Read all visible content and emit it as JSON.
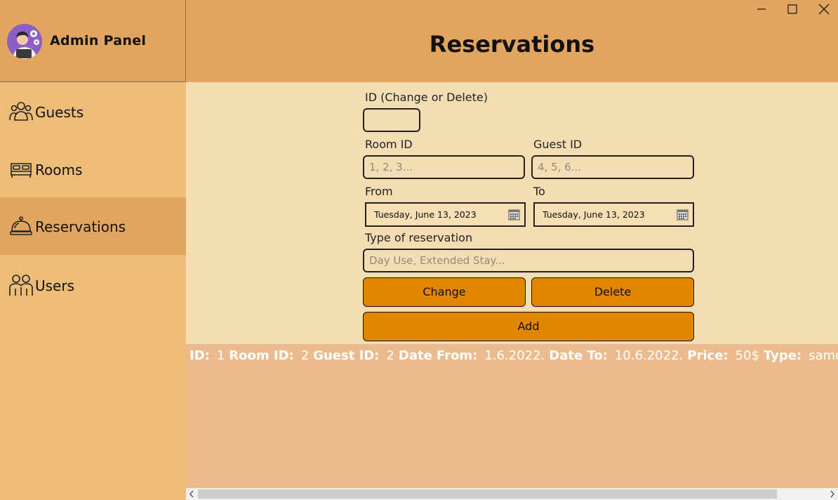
{
  "sidebar": {
    "title": "Admin Panel",
    "items": [
      {
        "label": "Guests"
      },
      {
        "label": "Rooms"
      },
      {
        "label": "Reservations"
      },
      {
        "label": "Users"
      }
    ],
    "active": "Reservations"
  },
  "header": {
    "title": "Reservations"
  },
  "form": {
    "id_label": "ID (Change or Delete)",
    "id_value": "",
    "room_id_label": "Room ID",
    "room_id_placeholder": "1, 2, 3...",
    "guest_id_label": "Guest ID",
    "guest_id_placeholder": "4, 5, 6...",
    "from_label": "From",
    "from_value": "Tuesday, June 13, 2023",
    "to_label": "To",
    "to_value": "Tuesday, June 13, 2023",
    "type_label": "Type of reservation",
    "type_placeholder": "Day Use, Extended Stay...",
    "change_button": "Change",
    "delete_button": "Delete",
    "add_button": "Add"
  },
  "list": {
    "rows": [
      {
        "id_key": "ID:",
        "id": "1",
        "room_key": "Room ID:",
        "room": "2",
        "guest_key": "Guest ID:",
        "guest": "2",
        "from_key": "Date From:",
        "from": "1.6.2022.",
        "to_key": "Date To:",
        "to": "10.6.2022.",
        "price_key": "Price:",
        "price": "50$",
        "type_key": "Type:",
        "type": "samo c"
      }
    ]
  },
  "colors": {
    "accent": "#e28500",
    "header": "#e2a55f",
    "sidebar": "#ecbc78",
    "form_bg": "#f5ddb3",
    "list_bg": "#ebbb8d"
  }
}
